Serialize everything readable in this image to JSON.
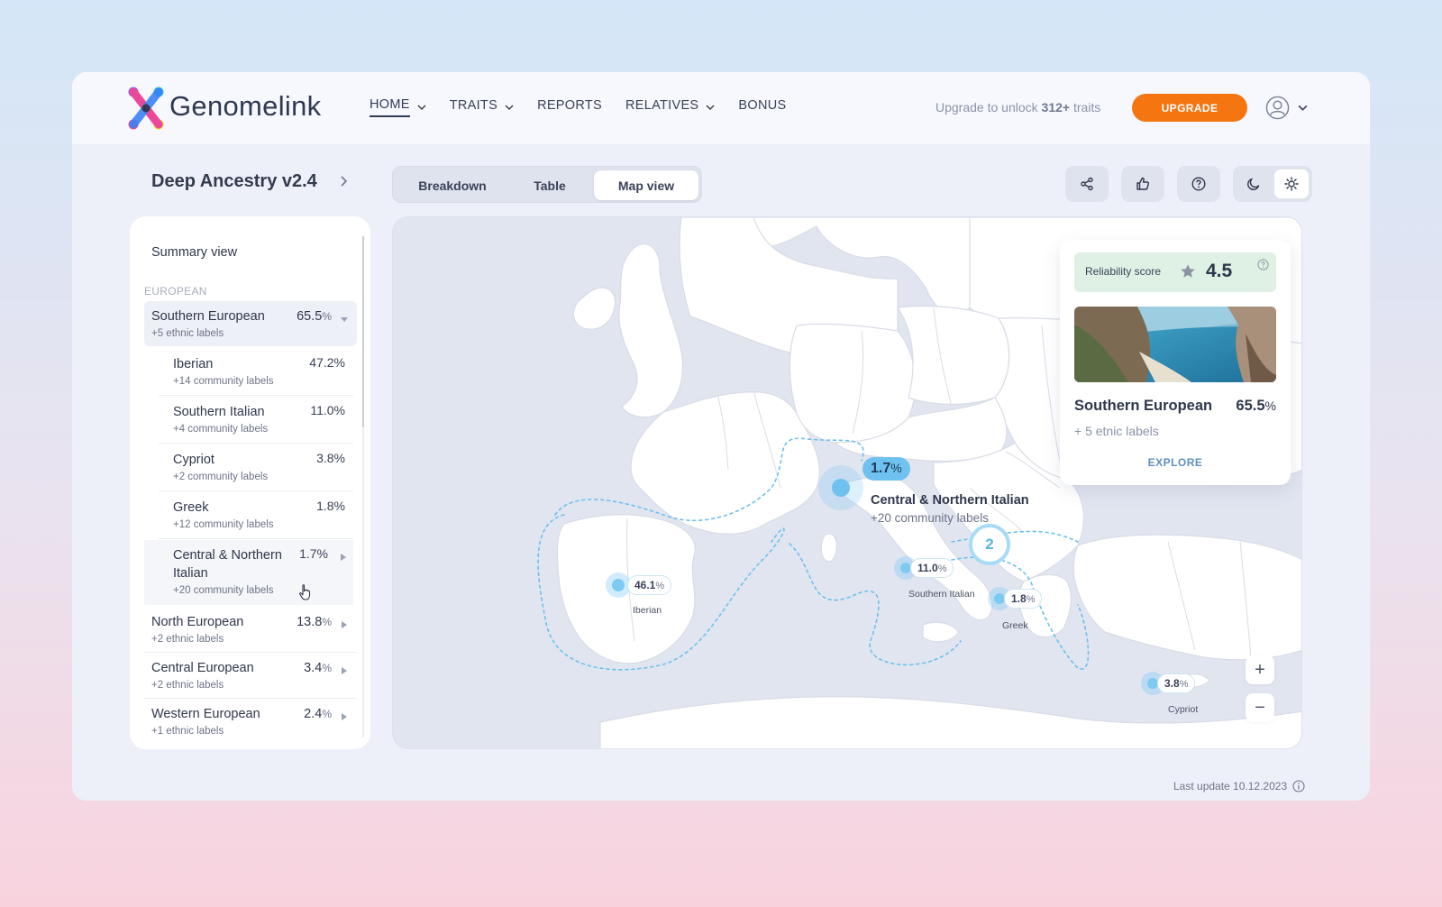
{
  "brand": {
    "name": "Genomelink"
  },
  "nav": {
    "items": [
      {
        "label": "HOME",
        "has_dropdown": true,
        "active": true
      },
      {
        "label": "TRAITS",
        "has_dropdown": true
      },
      {
        "label": "REPORTS",
        "has_dropdown": false
      },
      {
        "label": "RELATIVES",
        "has_dropdown": true
      },
      {
        "label": "BONUS",
        "has_dropdown": false
      }
    ],
    "upgrade_prefix": "Upgrade to unlock",
    "upgrade_count": "312+",
    "upgrade_suffix": "traits",
    "upgrade_button": "UPGRADE",
    "accent_color": "#f57510"
  },
  "page": {
    "title": "Deep Ancestry v2.4",
    "tabs": [
      "Breakdown",
      "Table",
      "Map view"
    ],
    "active_tab": "Map view",
    "toolbar_icons": [
      "share-icon",
      "thumbs-up-icon",
      "help-icon"
    ],
    "theme_icons": [
      "moon-icon",
      "sun-icon"
    ],
    "active_theme": "light"
  },
  "sidebar": {
    "summary": "Summary view",
    "section": "EUROPEAN",
    "groups": [
      {
        "name": "Southern European",
        "pct": "65.5",
        "sub": "+5 ethnic labels",
        "expanded": true,
        "children": [
          {
            "name": "Iberian",
            "pct": "47.2%",
            "sub": "+14 community labels"
          },
          {
            "name": "Southern Italian",
            "pct": "11.0%",
            "sub": "+4 community labels"
          },
          {
            "name": "Cypriot",
            "pct": "3.8%",
            "sub": "+2 community labels"
          },
          {
            "name": "Greek",
            "pct": "1.8%",
            "sub": "+12 community labels"
          },
          {
            "name": "Central & Northern Italian",
            "pct": "1.7%",
            "sub": "+20 community labels"
          }
        ]
      },
      {
        "name": "North European",
        "pct": "13.8",
        "sub": "+2 ethnic labels"
      },
      {
        "name": "Central European",
        "pct": "3.4",
        "sub": "+2 ethnic labels"
      },
      {
        "name": "Western European",
        "pct": "2.4",
        "sub": "+1 ethnic labels"
      }
    ]
  },
  "map": {
    "pins": [
      {
        "name": "Iberian",
        "pct": "46.1"
      },
      {
        "name": "Southern Italian",
        "pct": "11.0"
      },
      {
        "name": "Greek",
        "pct": "1.8"
      },
      {
        "name": "Cypriot",
        "pct": "3.8"
      }
    ],
    "highlight": {
      "name": "Central & Northern Italian",
      "pct": "1.7",
      "sub": "+20 community labels"
    },
    "cluster_count": "2",
    "zoom_in": "+",
    "zoom_out": "−",
    "pin_color": "#7dcaf3"
  },
  "card": {
    "reliability_label": "Reliability score",
    "reliability_score": "4.5",
    "name": "Southern European",
    "pct": "65.5",
    "sub": "+ 5 etnic labels",
    "explore": "EXPLORE"
  },
  "footer": {
    "last_update": "Last update 10.12.2023"
  }
}
